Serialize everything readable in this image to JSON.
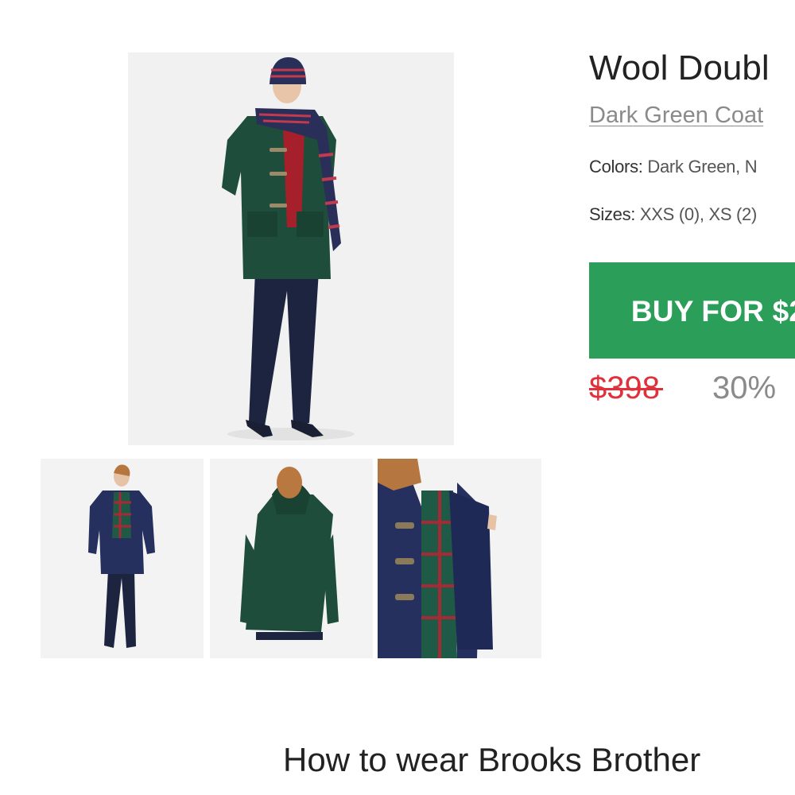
{
  "product": {
    "title": "Wool Doubl",
    "subtitle": "Dark Green Coat",
    "colors_label": "Colors:",
    "colors_value": "Dark Green, N",
    "sizes_label": "Sizes:",
    "sizes_value": "XXS (0), XS (2)",
    "buy_label": "BUY FOR $2",
    "old_price": "$398",
    "discount": "30%"
  },
  "section": {
    "heading": "How to wear Brooks Brother"
  },
  "colors": {
    "buy_button_bg": "#2b9e5a",
    "old_price": "#e0303a",
    "muted_text": "#8a8a8a",
    "coat_green": "#1f4d3b",
    "coat_navy": "#1e2a55"
  }
}
